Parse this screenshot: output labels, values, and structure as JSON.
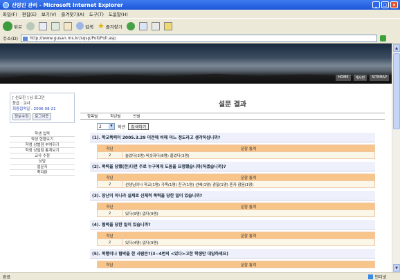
{
  "window": {
    "title": "산방진 관리 - Microsoft Internet Explorer"
  },
  "menu": [
    "파일(F)",
    "편집(E)",
    "보기(V)",
    "즐겨찾기(A)",
    "도구(T)",
    "도움말(H)"
  ],
  "toolbar": {
    "back": "뒤로",
    "search": "검색",
    "favorites": "즐겨찾기"
  },
  "address": {
    "label": "주소(D)",
    "url": "http://www.gusan.ms.kr/sqsp/Poll/Poll.asp"
  },
  "banner_links": [
    "HOME",
    "게시판",
    "SITEMAP"
  ],
  "user": {
    "greeting": "[ 신오진 ] 님 로그인",
    "grade": "등급 : 교사",
    "last_login": "최종접속일 : 2006-08-21",
    "btn_info": "정보수정",
    "btn_logout": "로그아웃"
  },
  "sidemenu": [
    "학생 입력",
    "학생 현황보기",
    "학생 상벌점 부여하기",
    "학생 상벌점 통계보기",
    "교사 수정",
    "상담",
    "설문지",
    "족자판"
  ],
  "page": {
    "title": "설문 결과"
  },
  "tabs": [
    "항목별",
    "학년별",
    "반별"
  ],
  "filter": {
    "year": "2",
    "grade_label": "학년",
    "search_button": "검색하기"
  },
  "table_header": {
    "col1": "학년",
    "col2": "문항 통계"
  },
  "questions": [
    {
      "title": "(1). 학교폭력이 2005.3.29 이전에 비해 어느 정도라고 생각하십니까?",
      "grade": "2",
      "stats": "늘었다(3명) 비슷하다(8명) 줄었다(3명)"
    },
    {
      "title": "(2). 폭력을 당했(한)다면 주로 누구에게 도움을 요청했습니까(하겠습니까)?",
      "grade": "2",
      "stats": "선생님이나 학교(1명) 가족(1명) 친구(1명) 선배(1명) 경찰(1명) 혼자 참음(1명)"
    },
    {
      "title": "(3). 장난이 아니라 실제로 신체적 폭력을 당한 일이 있습니까?",
      "grade": "2",
      "stats": "있다(9명) 없다(9명)"
    },
    {
      "title": "(4). 협박을 당한 일이 있습니까?",
      "grade": "2",
      "stats": "있다(4명) 없다(9명)"
    },
    {
      "title": "(5). 폭행이나 협박을 한 사람은?(3~4번의 <있다>고한 학생만 대답하세요)",
      "grade": "2",
      "stats": "문항 통계"
    }
  ],
  "status": {
    "left": "완료",
    "zone": "인터넷"
  }
}
